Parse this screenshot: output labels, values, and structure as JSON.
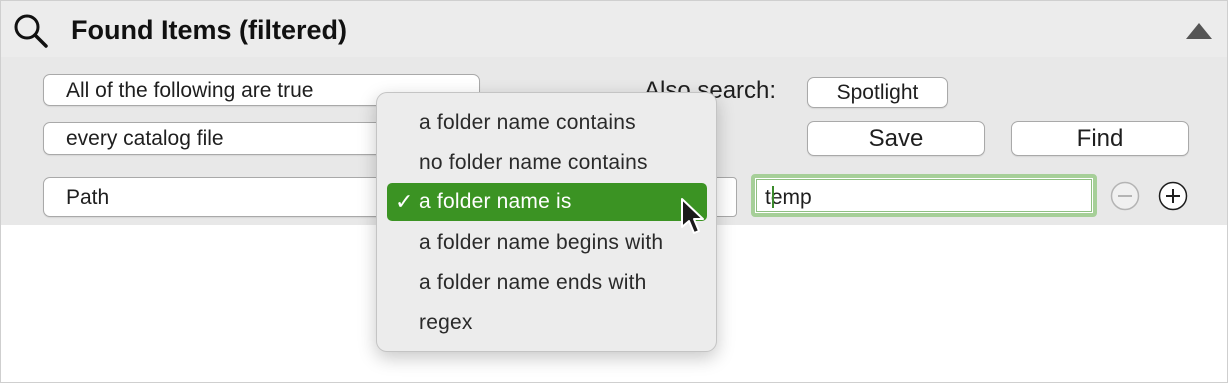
{
  "header": {
    "title": "Found Items  (filtered)",
    "icons": {
      "search": "magnifier-icon",
      "collapse": "triangle-up-icon"
    }
  },
  "criteria": {
    "match_mode": "All of the following are true",
    "scope": "every catalog file",
    "field": "Path",
    "operator": "a folder name is",
    "value": "temp",
    "also_search_label": "Also search:",
    "spotlight_label": "Spotlight",
    "save_label": "Save",
    "find_label": "Find",
    "icons": {
      "remove": "minus-circle-icon",
      "add": "plus-circle-icon"
    }
  },
  "operator_menu": {
    "items": [
      {
        "label": "a folder name contains",
        "selected": false
      },
      {
        "label": "no folder name contains",
        "selected": false
      },
      {
        "label": "a folder name is",
        "selected": true
      },
      {
        "label": "a folder name begins with",
        "selected": false
      },
      {
        "label": "a folder name ends with",
        "selected": false
      },
      {
        "label": "regex",
        "selected": false
      }
    ],
    "check_glyph": "✓"
  },
  "colors": {
    "accent": "#3b9323",
    "focus_ring": "#a6cf98",
    "header_bg": "#ececec",
    "criteria_bg": "#e8e8e8"
  }
}
